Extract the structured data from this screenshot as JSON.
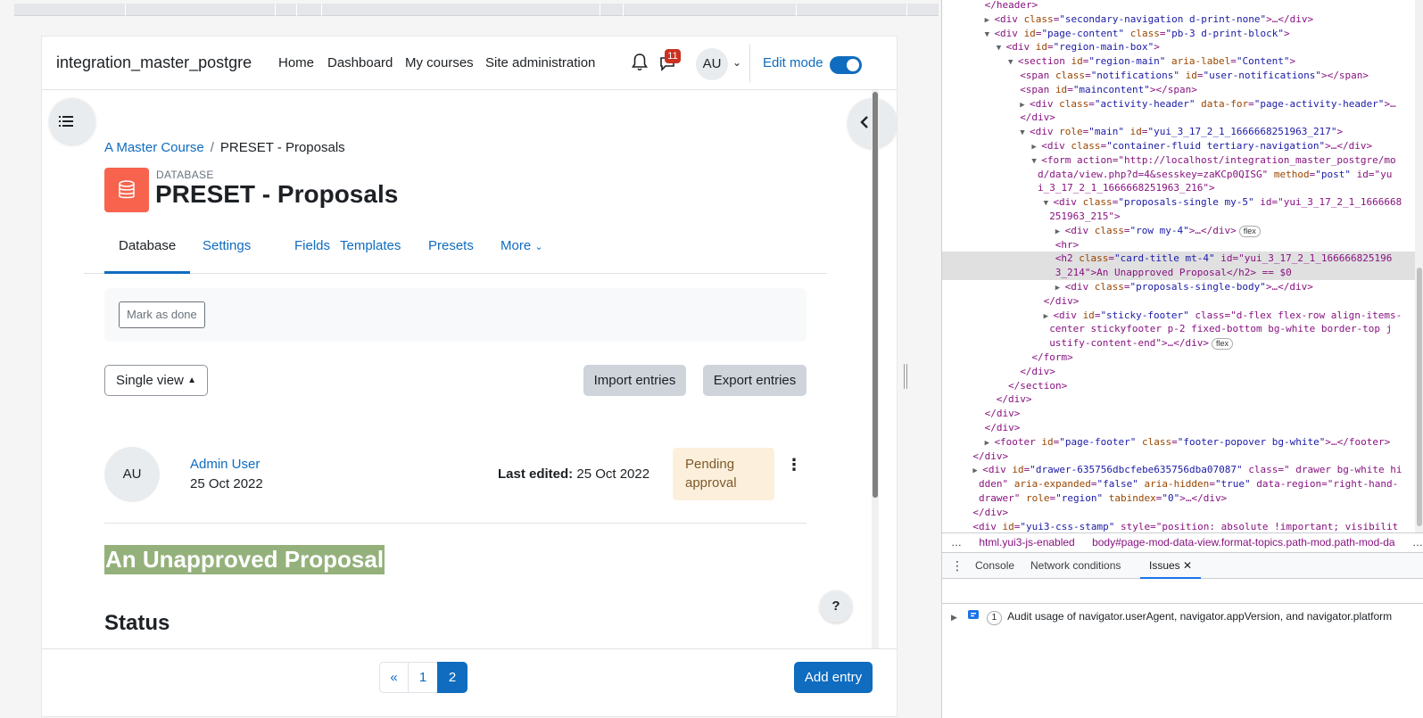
{
  "navbar": {
    "site_name": "integration_master_postgre",
    "links": [
      "Home",
      "Dashboard",
      "My courses",
      "Site administration"
    ],
    "message_count": "11",
    "user_initials": "AU",
    "edit_mode_label": "Edit mode"
  },
  "breadcrumb": {
    "course": "A Master Course",
    "separator": "/",
    "current": "PRESET - Proposals"
  },
  "activity": {
    "type": "DATABASE",
    "title": "PRESET - Proposals"
  },
  "tabs": [
    "Database",
    "Settings",
    "Fields",
    "Templates",
    "Presets",
    "More"
  ],
  "completion": {
    "mark_done": "Mark as done"
  },
  "toolbar": {
    "view_select": "Single view",
    "import": "Import entries",
    "export": "Export entries"
  },
  "entry": {
    "author_initials": "AU",
    "author": "Admin User",
    "date": "25 Oct 2022",
    "last_edited_label": "Last edited:",
    "last_edited_value": "25 Oct 2022",
    "status_badge_line1": "Pending",
    "status_badge_line2": "approval",
    "title": "An Unapproved Proposal",
    "section_heading": "Status"
  },
  "footer": {
    "pagination": [
      "«",
      "1",
      "2"
    ],
    "add_entry": "Add entry",
    "help": "?"
  },
  "devtools": {
    "lines": [
      {
        "indent": 6,
        "t": "</header>"
      },
      {
        "indent": 6,
        "tri": "▶",
        "t": "<div class=\"secondary-navigation d-print-none\">…</div>"
      },
      {
        "indent": 6,
        "tri": "▼",
        "t": "<div id=\"page-content\" class=\"pb-3 d-print-block\">"
      },
      {
        "indent": 8,
        "tri": "▼",
        "t": "<div id=\"region-main-box\">"
      },
      {
        "indent": 10,
        "tri": "▼",
        "t": "<section id=\"region-main\" aria-label=\"Content\">"
      },
      {
        "indent": 12,
        "t": "<span class=\"notifications\" id=\"user-notifications\"></span>"
      },
      {
        "indent": 12,
        "t": "<span id=\"maincontent\"></span>"
      },
      {
        "indent": 12,
        "tri": "▶",
        "t": "<div class=\"activity-header\" data-for=\"page-activity-header\">…"
      },
      {
        "indent": 12,
        "t": "</div>"
      },
      {
        "indent": 12,
        "tri": "▼",
        "t": "<div role=\"main\" id=\"yui_3_17_2_1_1666668251963_217\">"
      },
      {
        "indent": 14,
        "tri": "▶",
        "t": "<div class=\"container-fluid tertiary-navigation\">…</div>"
      },
      {
        "indent": 14,
        "tri": "▼",
        "t": "<form action=\"http://localhost/integration_master_postgre/mo"
      },
      {
        "indent": 15,
        "t": "d/data/view.php?d=4&sesskey=zaKCp0QISG\" method=\"post\" id=\"yu"
      },
      {
        "indent": 15,
        "t": "i_3_17_2_1_1666668251963_216\">"
      },
      {
        "indent": 16,
        "tri": "▼",
        "t": "<div class=\"proposals-single my-5\" id=\"yui_3_17_2_1_1666668"
      },
      {
        "indent": 17,
        "t": "251963_215\">"
      },
      {
        "indent": 18,
        "tri": "▶",
        "t": "<div class=\"row my-4\">…</div>",
        "chip": "flex"
      },
      {
        "indent": 18,
        "t": "<hr>"
      },
      {
        "indent": 18,
        "t": "<h2 class=\"card-title mt-4\" id=\"yui_3_17_2_1_166666825196",
        "selected": true
      },
      {
        "indent": 18,
        "t": "3_214\">An Unapproved Proposal</h2> == $0",
        "selected": true
      },
      {
        "indent": 18,
        "tri": "▶",
        "t": "<div class=\"proposals-single-body\">…</div>"
      },
      {
        "indent": 16,
        "t": "</div>"
      },
      {
        "indent": 16,
        "tri": "▶",
        "t": "<div id=\"sticky-footer\" class=\"d-flex flex-row align-items-"
      },
      {
        "indent": 17,
        "t": "center stickyfooter p-2 fixed-bottom bg-white border-top  j"
      },
      {
        "indent": 17,
        "t": "ustify-content-end\">…</div>",
        "chip": "flex"
      },
      {
        "indent": 14,
        "t": "</form>"
      },
      {
        "indent": 12,
        "t": "</div>"
      },
      {
        "indent": 10,
        "t": "</section>"
      },
      {
        "indent": 8,
        "t": "</div>"
      },
      {
        "indent": 6,
        "t": "</div>"
      },
      {
        "indent": 6,
        "t": "</div>"
      },
      {
        "indent": 6,
        "tri": "▶",
        "t": "<footer id=\"page-footer\" class=\"footer-popover bg-white\">…</footer>"
      },
      {
        "indent": 4,
        "t": "</div>"
      },
      {
        "indent": 4,
        "tri": "▶",
        "t": "<div id=\"drawer-635756dbcfebe635756dba07087\" class=\" drawer bg-white hi"
      },
      {
        "indent": 5,
        "t": "dden\" aria-expanded=\"false\" aria-hidden=\"true\" data-region=\"right-hand-"
      },
      {
        "indent": 5,
        "t": "drawer\" role=\"region\" tabindex=\"0\">…</div>"
      },
      {
        "indent": 4,
        "t": "</div>"
      },
      {
        "indent": 4,
        "t": "<div id=\"yui3-css-stamp\" style=\"position: absolute !important; visibilit"
      }
    ],
    "crumbs": [
      "…",
      "html.yui3-js-enabled",
      "body#page-mod-data-view.format-topics.path-mod.path-mod-da",
      "…"
    ],
    "drawer_tabs": [
      "Console",
      "Network conditions",
      "Issues"
    ],
    "issue_count": "1",
    "issue_text": "Audit usage of navigator.userAgent, navigator.appVersion, and navigator.platform"
  }
}
